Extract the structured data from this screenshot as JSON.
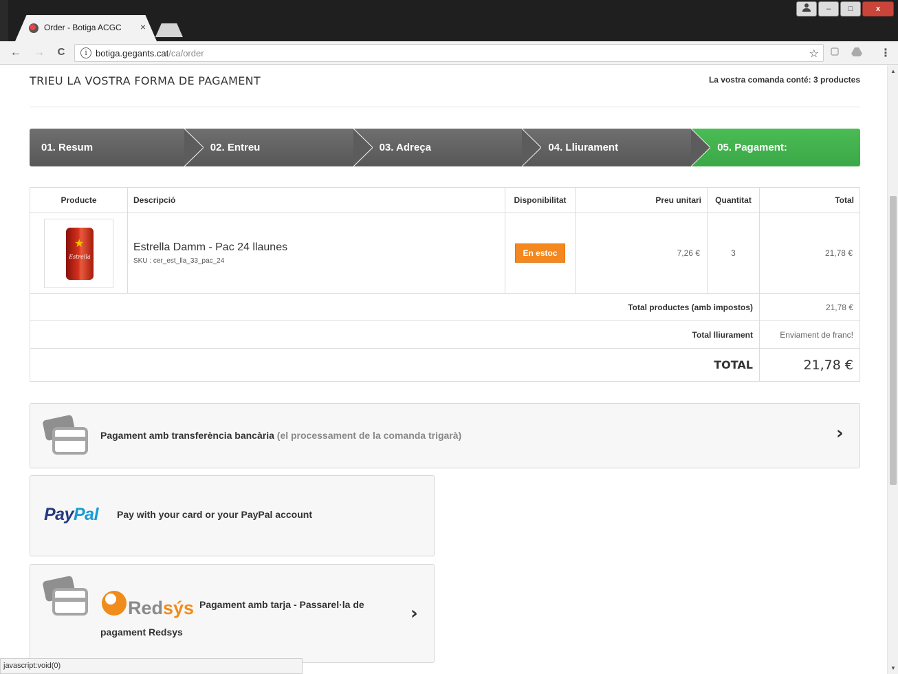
{
  "browser": {
    "tab_title": "Order - Botiga ACGC",
    "tab_close": "×",
    "url_host": "botiga.gegants.cat",
    "url_path": "/ca/order",
    "back": "←",
    "forward": "→",
    "reload": "C",
    "info": "i",
    "star": "☆",
    "menu": "⋮",
    "win_min": "–",
    "win_max": "□",
    "win_close": "x"
  },
  "header": {
    "title": "Trieu la vostra forma de pagament",
    "product_count": "La vostra comanda conté: 3 productes"
  },
  "steps": [
    {
      "label": "01. Resum",
      "active": false
    },
    {
      "label": "02. Entreu",
      "active": false
    },
    {
      "label": "03. Adreça",
      "active": false
    },
    {
      "label": "04. Lliurament",
      "active": false
    },
    {
      "label": "05. Pagament:",
      "active": true
    }
  ],
  "cart": {
    "headers": {
      "product": "Producte",
      "description": "Descripció",
      "availability": "Disponibilitat",
      "unit_price": "Preu unitari",
      "quantity": "Quantitat",
      "total": "Total"
    },
    "items": [
      {
        "name": "Estrella Damm - Pac 24 llaunes",
        "sku": "SKU : cer_est_lla_33_pac_24",
        "can_text": "Estrella",
        "availability": "En estoc",
        "unit_price": "7,26 €",
        "quantity": "3",
        "total": "21,78 €"
      }
    ],
    "total_products_label": "Total productes (amb impostos)",
    "total_products_value": "21,78 €",
    "total_shipping_label": "Total lliurament",
    "total_shipping_value": "Enviament de franc!",
    "grand_total_label": "TOTAL",
    "grand_total_value": "21,78 €"
  },
  "payment": {
    "bank_label": "Pagament amb transferència bancària",
    "bank_note": "(el processament de la comanda trigarà)",
    "paypal_logo_a": "Pay",
    "paypal_logo_b": "Pal",
    "paypal_label": "Pay with your card or your PayPal account",
    "redsys_word_a": "Red",
    "redsys_word_b": "sýs",
    "redsys_label": "Pagament amb tarja - Passarel·la de",
    "redsys_label_2": "pagament Redsys",
    "chevron": "›"
  },
  "status_bar": "javascript:void(0)",
  "colors": {
    "step_bg": "#626262",
    "step_active": "#43b14f",
    "badge": "#f5871f",
    "paypal_dark": "#253b80",
    "paypal_light": "#179bd7",
    "redsys_orange": "#f08c1c"
  }
}
